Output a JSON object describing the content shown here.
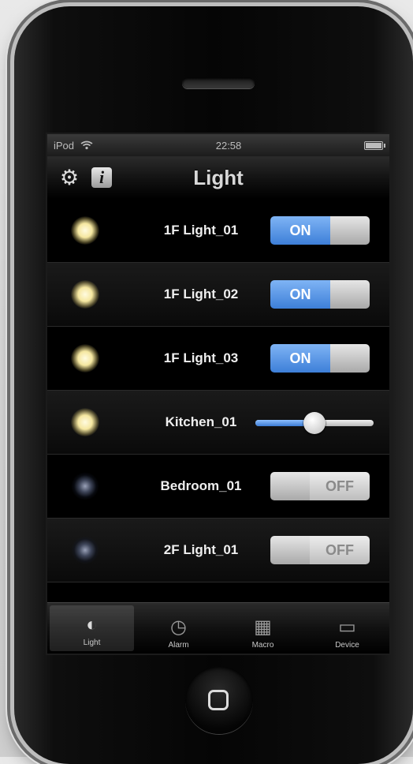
{
  "status_bar": {
    "carrier": "iPod",
    "wifi_icon": "wifi-icon",
    "time": "22:58",
    "battery_icon": "battery-icon"
  },
  "nav": {
    "title": "Light",
    "settings_icon": "gear-icon",
    "info_label": "i"
  },
  "lights": [
    {
      "name": "1F Light_01",
      "control": "toggle",
      "state": "ON",
      "bulb": "on"
    },
    {
      "name": "1F Light_02",
      "control": "toggle",
      "state": "ON",
      "bulb": "on"
    },
    {
      "name": "1F Light_03",
      "control": "toggle",
      "state": "ON",
      "bulb": "on"
    },
    {
      "name": "Kitchen_01",
      "control": "slider",
      "level": 0.5,
      "bulb": "on"
    },
    {
      "name": "Bedroom_01",
      "control": "toggle",
      "state": "OFF",
      "bulb": "off"
    },
    {
      "name": "2F Light_01",
      "control": "toggle",
      "state": "OFF",
      "bulb": "off"
    }
  ],
  "tabs": [
    {
      "label": "Light",
      "icon": "bulb-icon",
      "glyph": "◐",
      "active": true
    },
    {
      "label": "Alarm",
      "icon": "clock-icon",
      "glyph": "◷",
      "active": false
    },
    {
      "label": "Macro",
      "icon": "macro-icon",
      "glyph": "▦",
      "active": false
    },
    {
      "label": "Device",
      "icon": "monitor-icon",
      "glyph": "▭",
      "active": false
    }
  ],
  "colors": {
    "toggle_on": "#3d7fd8",
    "background": "#000000"
  }
}
